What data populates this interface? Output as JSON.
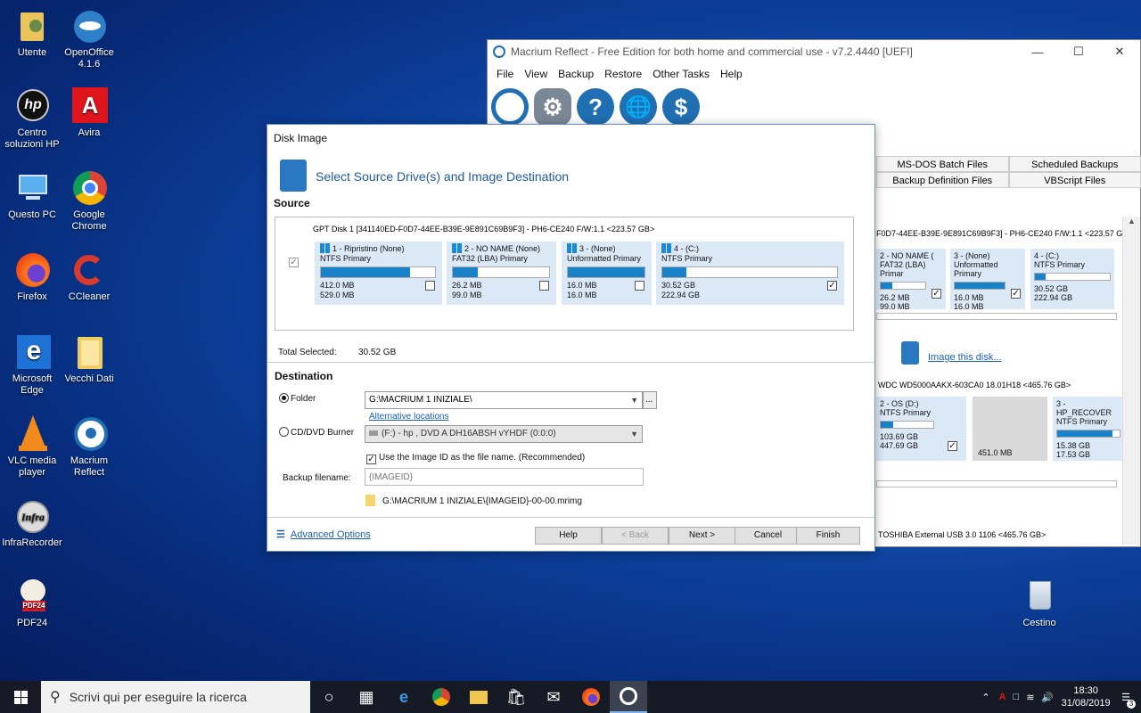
{
  "desktop_icons": [
    {
      "label": "Utente",
      "icon": "user-folder-icon"
    },
    {
      "label": "OpenOffice 4.1.6",
      "icon": "openoffice-icon"
    },
    {
      "label": "Centro soluzioni HP",
      "icon": "hp-icon"
    },
    {
      "label": "Avira",
      "icon": "avira-icon"
    },
    {
      "label": "Questo PC",
      "icon": "computer-icon"
    },
    {
      "label": "Google Chrome",
      "icon": "chrome-icon"
    },
    {
      "label": "Firefox",
      "icon": "firefox-icon"
    },
    {
      "label": "CCleaner",
      "icon": "ccleaner-icon"
    },
    {
      "label": "Microsoft Edge",
      "icon": "edge-icon"
    },
    {
      "label": "Vecchi Dati",
      "icon": "folder-icon"
    },
    {
      "label": "VLC media player",
      "icon": "vlc-icon"
    },
    {
      "label": "Macrium Reflect",
      "icon": "macrium-icon"
    },
    {
      "label": "InfraRecorder",
      "icon": "infrarecorder-icon"
    },
    {
      "label": "PDF24",
      "icon": "pdf24-icon"
    },
    {
      "label": "Cestino",
      "icon": "recycle-bin-icon"
    }
  ],
  "main_window": {
    "title": "Macrium Reflect - Free Edition for both home and commercial use - v7.2.4440  [UEFI]",
    "menu": [
      "File",
      "View",
      "Backup",
      "Restore",
      "Other Tasks",
      "Help"
    ],
    "tabs_row1": [
      "MS-DOS Batch Files",
      "Scheduled Backups"
    ],
    "tabs_row2": [
      "Backup Definition Files",
      "VBScript Files"
    ],
    "disk1_header": "F0D7-44EE-B39E-9E891C69B9F3] - PH6-CE240 F/W:1.1  <223.57 GB>",
    "disk1_parts": [
      {
        "name": "2 - NO NAME (",
        "type": "FAT32 (LBA) Primar",
        "used": "26.2 MB",
        "total": "99.0 MB",
        "fill": 0.26
      },
      {
        "name": "3 - (None)",
        "type": "Unformatted Primary",
        "used": "16.0 MB",
        "total": "16.0 MB",
        "fill": 1.0
      },
      {
        "name": "4 - (C:)",
        "type": "NTFS Primary",
        "used": "30.52 GB",
        "total": "222.94 GB",
        "fill": 0.14
      }
    ],
    "image_this_disk": "Image this disk...",
    "disk2_header": "WDC WD5000AAKX-603CA0 18.01H18  <465.76 GB>",
    "disk2_parts": [
      {
        "name": "2 - OS (D:)",
        "type": "NTFS Primary",
        "used": "103.69 GB",
        "total": "447.69 GB",
        "fill": 0.23
      },
      {
        "name": "",
        "type": "",
        "used": "",
        "total": "451.0 MB",
        "fill": 0
      },
      {
        "name": "3 - HP_RECOVER",
        "type": "NTFS Primary",
        "used": "15.38 GB",
        "total": "17.53 GB",
        "fill": 0.88
      }
    ],
    "disk3_header": "TOSHIBA  External USB 3.0 1106  <465.76 GB>"
  },
  "dialog": {
    "title": "Disk Image",
    "heading": "Select Source Drive(s) and Image Destination",
    "source_label": "Source",
    "disk_header": "GPT Disk 1 [341140ED-F0D7-44EE-B39E-9E891C69B9F3] - PH6-CE240 F/W:1.1  <223.57 GB>",
    "partitions": [
      {
        "name": "1 - Ripristino (None)",
        "type": "NTFS Primary",
        "used": "412.0 MB",
        "total": "529.0 MB",
        "fill": 0.78,
        "checked": false
      },
      {
        "name": "2 - NO NAME (None)",
        "type": "FAT32 (LBA) Primary",
        "used": "26.2 MB",
        "total": "99.0 MB",
        "fill": 0.26,
        "checked": false
      },
      {
        "name": "3 -  (None)",
        "type": "Unformatted Primary",
        "used": "16.0 MB",
        "total": "16.0 MB",
        "fill": 1.0,
        "checked": false
      },
      {
        "name": "4 -  (C:)",
        "type": "NTFS Primary",
        "used": "30.52 GB",
        "total": "222.94 GB",
        "fill": 0.14,
        "checked": true
      }
    ],
    "total_selected_label": "Total Selected:",
    "total_selected_value": "30.52 GB",
    "destination_label": "Destination",
    "folder_label": "Folder",
    "folder_value": "G:\\MACRIUM 1 INIZIALE\\",
    "alternative_locations": "Alternative locations",
    "cd_label": "CD/DVD Burner",
    "cd_value": "(F:) - hp      , DVD A  DH16ABSH  vYHDF (0:0:0)",
    "use_image_id": "Use the Image ID as the file name.  (Recommended)",
    "backup_filename_label": "Backup filename:",
    "backup_filename_placeholder": "{IMAGEID}",
    "path_preview": "G:\\MACRIUM 1 INIZIALE\\{IMAGEID}-00-00.mrimg",
    "advanced_options": "Advanced Options",
    "buttons": {
      "help": "Help",
      "back": "< Back",
      "next": "Next >",
      "cancel": "Cancel",
      "finish": "Finish"
    }
  },
  "taskbar": {
    "search_placeholder": "Scrivi qui per eseguire la ricerca",
    "time": "18:30",
    "date": "31/08/2019",
    "notifications": "3"
  }
}
